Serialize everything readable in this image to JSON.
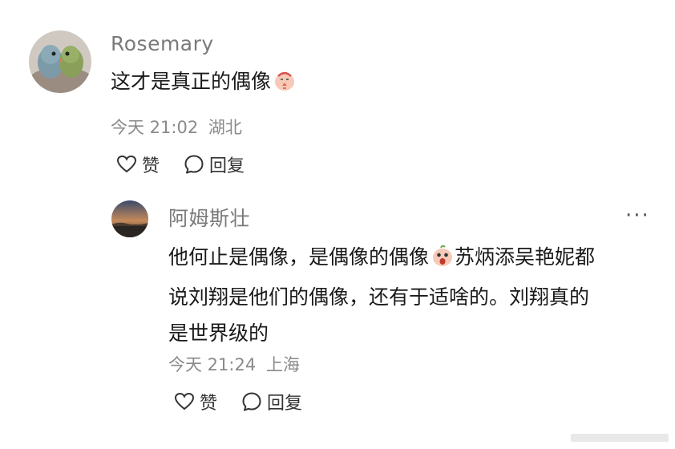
{
  "comment": {
    "author": "Rosemary",
    "text": "这才是真正的偶像",
    "emoji": "prayer-emoji",
    "time": "今天 21:02",
    "location": "湖北",
    "like_label": "赞",
    "reply_label": "回复"
  },
  "reply": {
    "author": "阿姆斯壮",
    "line1": "他何止是偶像，是偶像的偶像",
    "line1_after_emoji": "苏炳添吴艳妮都",
    "line2": "说刘翔是他们的偶像，还有于适啥的。刘翔真的",
    "line3": "是世界级的",
    "emoji": "shocked-emoji",
    "time": "今天 21:24",
    "location": "上海",
    "like_label": "赞",
    "reply_label": "回复",
    "more_label": "···"
  }
}
